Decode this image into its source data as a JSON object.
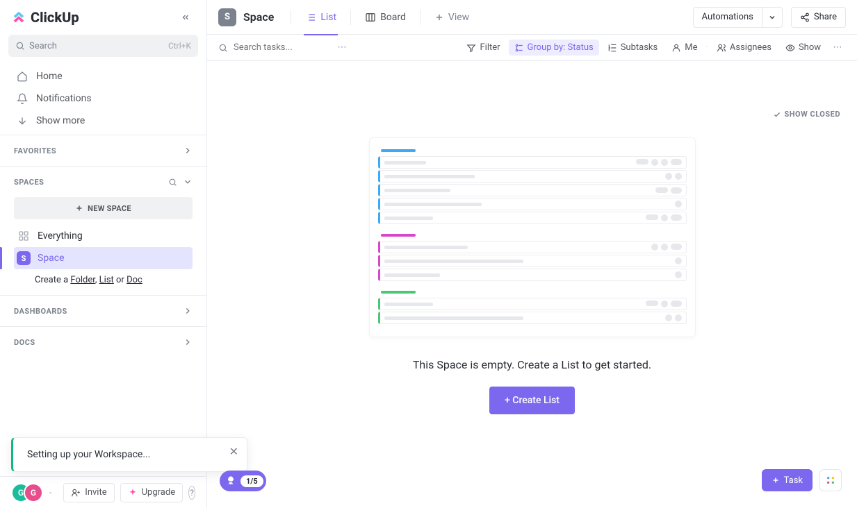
{
  "brand": "ClickUp",
  "sidebar": {
    "search_placeholder": "Search",
    "search_shortcut": "Ctrl+K",
    "nav": {
      "home": "Home",
      "notifications": "Notifications",
      "show_more": "Show more"
    },
    "favorites_label": "FAVORITES",
    "spaces_label": "SPACES",
    "new_space": "NEW SPACE",
    "everything": "Everything",
    "space_name": "Space",
    "space_initial": "S",
    "create_prefix": "Create a ",
    "create_folder": "Folder",
    "create_list": "List",
    "create_doc": "Doc",
    "create_or": " or ",
    "dashboards_label": "DASHBOARDS",
    "docs_label": "DOCS"
  },
  "toast": {
    "message": "Setting up your Workspace..."
  },
  "footer": {
    "avatar1": "G",
    "avatar2": "G",
    "invite": "Invite",
    "upgrade": "Upgrade"
  },
  "header": {
    "space_initial": "S",
    "space_title": "Space",
    "tab_list": "List",
    "tab_board": "Board",
    "tab_view": "View",
    "automations": "Automations",
    "share": "Share"
  },
  "toolbar": {
    "search_placeholder": "Search tasks...",
    "filter": "Filter",
    "group_by": "Group by: Status",
    "subtasks": "Subtasks",
    "me": "Me",
    "assignees": "Assignees",
    "show": "Show"
  },
  "content": {
    "show_closed": "SHOW CLOSED",
    "empty_msg": "This Space is empty. Create a List to get started.",
    "create_list": "+ Create List"
  },
  "onboard_count": "1/5",
  "task_fab": "Task"
}
